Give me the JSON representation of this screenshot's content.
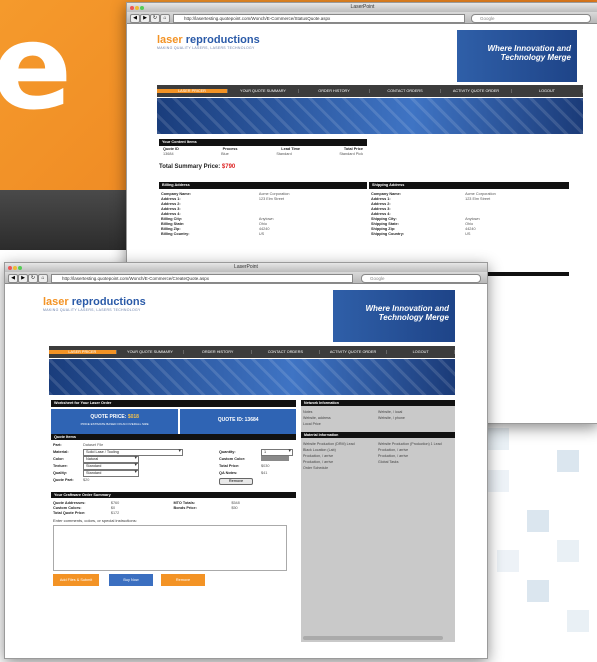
{
  "hero_glyph": "e",
  "back_window": {
    "title": "LaserPoint",
    "url": "http://lasertesting.quotepoint.com/Wonch/E-Commerce/StatusQuote.aspx",
    "search_placeholder": "Google",
    "logo": {
      "laser": "laser",
      "rest": " reproductions",
      "tagline": "MAKING QUALITY LASERS, LASERS TECHNOLOGY"
    },
    "banner": {
      "line1": "Where Innovation and",
      "line2": "Technology Merge"
    },
    "menu": [
      "LASER PRICER",
      "YOUR QUOTE SUMMARY",
      "ORDER HISTORY",
      "CONTACT ORDERS",
      "ACTIVITY QUOTE ORDER",
      "LOGOUT"
    ],
    "content_fields": {
      "title": "Your Content Items",
      "headers": [
        "Quote ID",
        "Process",
        "Lead Time",
        "Total Price"
      ],
      "row": [
        "13684",
        "Blue",
        "Standard",
        "Standard Pick"
      ]
    },
    "total": {
      "label": "Total Summary Price:",
      "value": "$790"
    },
    "billing": {
      "title": "Billing Address",
      "rows": [
        [
          "Company Name:",
          "Acme Corporation"
        ],
        [
          "Address 1:",
          "123 Elm Street"
        ],
        [
          "Address 2:",
          ""
        ],
        [
          "Address 3:",
          ""
        ],
        [
          "Address 4:",
          ""
        ],
        [
          "Billing City:",
          "Anytown"
        ],
        [
          "Billing State:",
          "Ohio"
        ],
        [
          "Billing Zip:",
          "44240"
        ],
        [
          "Billing Country:",
          "US"
        ]
      ]
    },
    "shipping": {
      "title": "Shipping Address",
      "rows": [
        [
          "Company Name:",
          "Acme Corporation"
        ],
        [
          "Address 1:",
          "123 Elm Street"
        ],
        [
          "Address 2:",
          ""
        ],
        [
          "Address 3:",
          ""
        ],
        [
          "Address 4:",
          ""
        ],
        [
          "Shipping City:",
          "Anytown"
        ],
        [
          "Shipping State:",
          "Ohio"
        ],
        [
          "Shipping Zip:",
          "44240"
        ],
        [
          "Shipping Country:",
          "US"
        ]
      ]
    }
  },
  "front_window": {
    "title": "LaserPoint",
    "url": "http://lasertesting.quotepoint.com/Wonch/E-Commerce/CreateQuote.aspx",
    "search_placeholder": "Google",
    "logo": {
      "laser": "laser",
      "rest": " reproductions",
      "tagline": "MAKING QUALITY LASERS, LASERS TECHNOLOGY"
    },
    "banner": {
      "line1": "Where Innovation and",
      "line2": "Technology Merge"
    },
    "menu": [
      "LASER PRICER",
      "YOUR QUOTE SUMMARY",
      "ORDER HISTORY",
      "CONTACT ORDERS",
      "ACTIVITY QUOTE ORDER",
      "LOGOUT"
    ],
    "worksheet": {
      "title": "Worksheet for Your Laser Order",
      "quote_price_label": "QUOTE PRICE:",
      "quote_price_value": "$018",
      "quote_price_note": "PRICE ESTIMATE BASED ON AN OVERALL SIZE",
      "quote_id_label": "QUOTE ID:",
      "quote_id_value": "13684"
    },
    "quote_items": {
      "title": "Quote Items",
      "part_label": "Part:",
      "part_value": "Dataset File",
      "material_label": "Material:",
      "material_value": "Solid Lase / Tooling",
      "color_label": "Color:",
      "color_value": "Natural",
      "texture_label": "Texture:",
      "texture_value": "Standard",
      "quality_label": "Quality:",
      "quality_value": "Standard",
      "quote_part_label": "Quote Part:",
      "quote_part_value": "$20",
      "quantity_label": "Quantity:",
      "quantity_value": "1",
      "custom_color_label": "Custom Color:",
      "total_price_label": "Total Price:",
      "total_price_value": "$030",
      "qa_notes_label": "QA Notes:",
      "qa_notes_value": "$41",
      "remove_label": "Remove"
    },
    "summary": {
      "title": "Your Craftware Order Summary",
      "left": [
        [
          "Quote Addresses:",
          "$760"
        ],
        [
          "Custom Colors:",
          "$0"
        ],
        [
          "Total Quote Price:",
          "$172"
        ]
      ],
      "right": [
        [
          "MTO Totals:",
          "$548"
        ],
        [
          "Bonds Price:",
          "$50"
        ]
      ]
    },
    "comments_label": "Enter comments, colors, or special instructions:",
    "buttons": {
      "add_files": "Add Files & Submit",
      "buy_now": "Buy Now",
      "remove": "Remove"
    },
    "network": {
      "title": "Network Information",
      "left": [
        "Notes",
        "Website, address",
        "Local Price"
      ],
      "right": [
        "Website, / local",
        "Website, / phone"
      ]
    },
    "material": {
      "title": "Material Information",
      "left": [
        "Website Production (DRM) Lead",
        "Black Location (Lab)",
        "Production, / arrive",
        "Production, / arrive",
        "Order Schedule"
      ],
      "right": [
        "Website Production (Production) 1 Lead",
        "Production, / arrive",
        "Production, / arrive",
        "Global Tasks"
      ]
    }
  }
}
